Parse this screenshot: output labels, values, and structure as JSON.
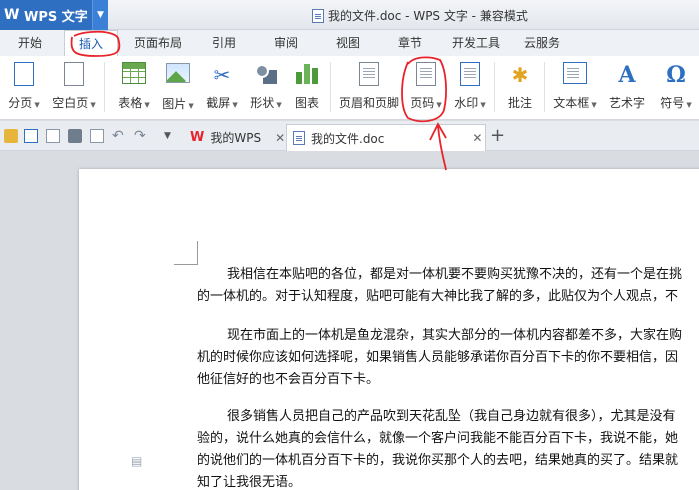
{
  "app": {
    "name": "WPS 文字",
    "window_title": "我的文件.doc - WPS 文字 - 兼容模式"
  },
  "menu_tabs": [
    "开始",
    "插入",
    "页面布局",
    "引用",
    "审阅",
    "视图",
    "章节",
    "开发工具",
    "云服务"
  ],
  "active_menu_tab": "插入",
  "ribbon": {
    "page_break": "分页",
    "blank_page": "空白页",
    "table": "表格",
    "picture": "图片",
    "screenshot": "截屏",
    "shape": "形状",
    "chart": "图表",
    "header_footer": "页眉和页脚",
    "page_number": "页码",
    "watermark": "水印",
    "comment": "批注",
    "textbox": "文本框",
    "wordart": "艺术字",
    "symbol": "符号"
  },
  "doc_tabs": [
    {
      "label": "我的WPS",
      "icon": "wps-logo-icon"
    },
    {
      "label": "我的文件.doc",
      "icon": "document-icon"
    }
  ],
  "document": {
    "paragraphs": [
      [
        "我相信在本贴吧的各位，都是对一体机要不要购买犹豫不决的，还有一个是在挑",
        "的一体机的。对于认知程度，贴吧可能有大神比我了解的多，此贴仅为个人观点，不"
      ],
      [
        "现在市面上的一体机是鱼龙混杂，其实大部分的一体机内容都差不多，大家在购",
        "机的时候你应该如何选择呢，如果销售人员能够承诺你百分百下卡的你不要相信，因",
        "他征信好的也不会百分百下卡。"
      ],
      [
        "很多销售人员把自己的产品吹到天花乱坠（我自己身边就有很多），尤其是没有",
        "验的，说什么她真的会信什么，就像一个客户问我能不能百分百下卡，我说不能，她",
        "的说他们的一体机百分百下卡的，我说你买那个人的去吧，结果她真的买了。结果就",
        "知了让我很无语。"
      ]
    ]
  },
  "colors": {
    "accent": "#2f6fc2",
    "annotation": "#e8232b"
  }
}
